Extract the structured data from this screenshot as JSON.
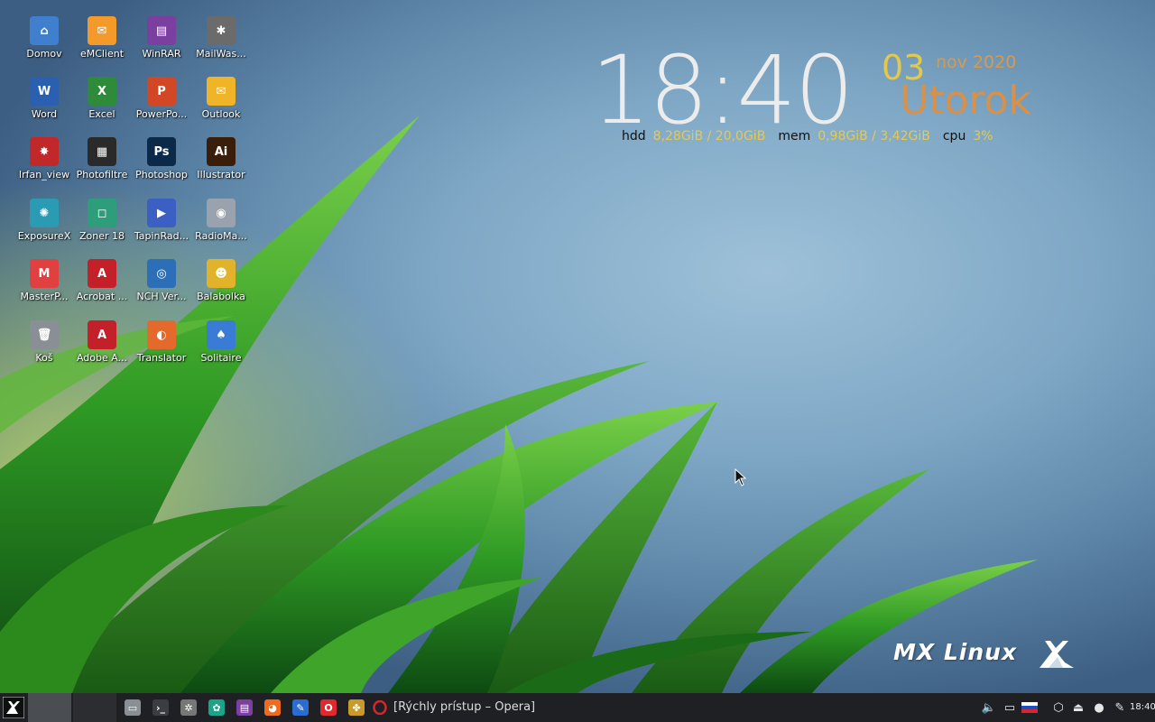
{
  "desktop": {
    "icons": [
      {
        "label": "Domov",
        "icon": "home-folder-icon",
        "color": "#3f7fce"
      },
      {
        "label": "eMClient",
        "icon": "emclient-icon",
        "color": "#f39a2b"
      },
      {
        "label": "WinRAR",
        "icon": "winrar-icon",
        "color": "#7b3fa0"
      },
      {
        "label": "MailWas...",
        "icon": "mailwasher-icon",
        "color": "#6b6b6b"
      },
      {
        "label": "Word",
        "icon": "word-icon",
        "color": "#2b5fb0"
      },
      {
        "label": "Excel",
        "icon": "excel-icon",
        "color": "#2e8b3a"
      },
      {
        "label": "PowerPo...",
        "icon": "powerpoint-icon",
        "color": "#d24726"
      },
      {
        "label": "Outlook",
        "icon": "outlook-icon",
        "color": "#f0b428"
      },
      {
        "label": "Irfan_view",
        "icon": "irfanview-icon",
        "color": "#c0282a"
      },
      {
        "label": "Photofiltre",
        "icon": "photofiltre-icon",
        "color": "#2a2a2a"
      },
      {
        "label": "Photoshop",
        "icon": "photoshop-icon",
        "color": "#0b2a4a"
      },
      {
        "label": "Illustrator",
        "icon": "illustrator-icon",
        "color": "#3a1e0a"
      },
      {
        "label": "ExposureX",
        "icon": "exposurex-icon",
        "color": "#2b9bb4"
      },
      {
        "label": "Zoner 18",
        "icon": "zoner-icon",
        "color": "#2e9e7a"
      },
      {
        "label": "TapinRad...",
        "icon": "tapinradio-icon",
        "color": "#3b5fc2"
      },
      {
        "label": "RadioMa...",
        "icon": "radiomaximus-icon",
        "color": "#9aa3ad"
      },
      {
        "label": "MasterP...",
        "icon": "masterpdf-icon",
        "color": "#e04040"
      },
      {
        "label": "Acrobat ...",
        "icon": "acrobat-icon",
        "color": "#c4202a"
      },
      {
        "label": "NCH Ver...",
        "icon": "nch-icon",
        "color": "#2c6fb8"
      },
      {
        "label": "Balabolka",
        "icon": "balabolka-icon",
        "color": "#e2b22a"
      },
      {
        "label": "Koš",
        "icon": "trash-icon",
        "color": "#8a8f96"
      },
      {
        "label": "Adobe A...",
        "icon": "adobe-reader-icon",
        "color": "#c4202a"
      },
      {
        "label": "Translator",
        "icon": "translator-icon",
        "color": "#e36a2c"
      },
      {
        "label": "Solitaire",
        "icon": "solitaire-icon",
        "color": "#3a7bd5"
      }
    ]
  },
  "conky": {
    "time": "18:40",
    "day": "03",
    "month_year": "nov 2020",
    "weekday": "Utorok",
    "hdd_label": "hdd",
    "hdd_value": "8,28GiB / 20,0GiB",
    "mem_label": "mem",
    "mem_value": "0,98GiB / 3,42GiB",
    "cpu_label": "cpu",
    "cpu_value": "3%"
  },
  "wallpaper": {
    "logo_text": "MX Linux"
  },
  "taskbar": {
    "launchers": [
      {
        "icon": "file-manager-icon",
        "color": "#8a8f96"
      },
      {
        "icon": "terminal-icon",
        "color": "#3a3d42"
      },
      {
        "icon": "settings-wheel-icon",
        "color": "#777"
      },
      {
        "icon": "mx-tools-icon",
        "color": "#1aa58b"
      },
      {
        "icon": "winrar-icon",
        "color": "#7b3fa0"
      },
      {
        "icon": "firefox-icon",
        "color": "#f06b1e"
      },
      {
        "icon": "writer-icon",
        "color": "#2b6ccf"
      },
      {
        "icon": "opera-icon",
        "color": "#e0282e"
      },
      {
        "icon": "pinwheel-icon",
        "color": "#c99a2a"
      }
    ],
    "active_task": {
      "icon": "opera-icon",
      "title": "[Rýchly prístup – Opera]"
    },
    "tray": [
      {
        "icon": "volume-icon"
      },
      {
        "icon": "display-icon"
      },
      {
        "icon": "slovak-flag-icon"
      },
      {
        "icon": "network-icon"
      },
      {
        "icon": "eject-icon"
      },
      {
        "icon": "updater-icon"
      },
      {
        "icon": "clipboard-icon"
      }
    ],
    "clock": "18:40"
  }
}
